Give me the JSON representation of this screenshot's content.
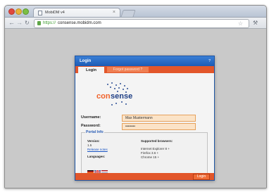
{
  "browser": {
    "tab_title": "MobiDM v4",
    "tab_close": "×",
    "url_scheme": "https://",
    "url_host": "consense.mobidm.com",
    "back_icon": "back-arrow-icon",
    "forward_icon": "forward-arrow-icon",
    "reload_icon": "reload-icon",
    "bookmark_icon": "star-icon",
    "menu_icon": "wrench-icon"
  },
  "dialog": {
    "title": "Login",
    "help_icon": "?",
    "tabs": [
      {
        "label": "Login",
        "active": true
      },
      {
        "label": "Forgot password ?",
        "active": false
      }
    ],
    "logo": {
      "part1": "con",
      "part2": "sense"
    },
    "username_label": "Username:",
    "username_value": "Max Mustermann",
    "password_label": "Password:",
    "password_value": "••••••••",
    "portal_info": {
      "legend": "Portal Info",
      "version_label": "Version:",
      "version_value": "1.5",
      "release_notes": "Release notes",
      "languages_label": "Languages:",
      "browsers_label": "Supported browsers:",
      "browsers": [
        "Internet Explorer 8 +",
        "Firefox 3.6 +",
        "Chrome 15 +"
      ]
    },
    "login_button": "Login"
  },
  "colors": {
    "accent_orange": "#e2562a",
    "header_blue": "#2a6ac7",
    "field_fill": "#fbe3c7"
  }
}
